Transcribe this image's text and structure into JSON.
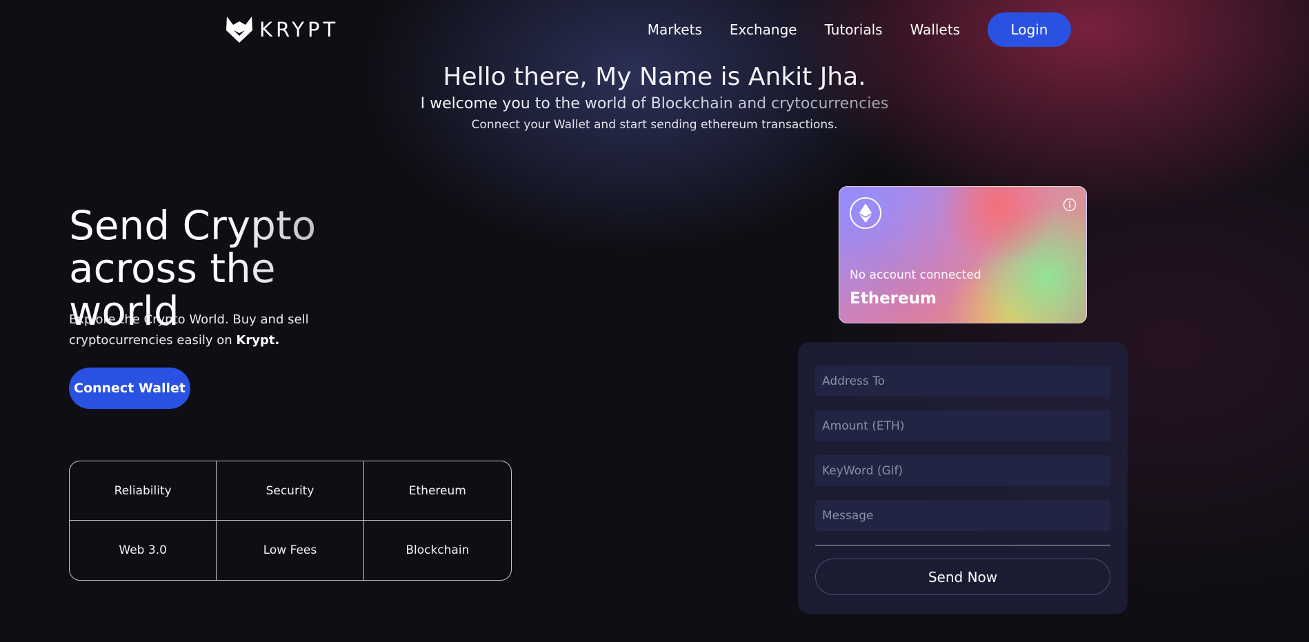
{
  "brand": {
    "name": "KRYPT",
    "logo_icon": "fox-logo-icon"
  },
  "nav": {
    "links": [
      "Markets",
      "Exchange",
      "Tutorials",
      "Wallets"
    ],
    "login_label": "Login"
  },
  "intro": {
    "heading": "Hello there, My Name is Ankit Jha.",
    "subheading": "I welcome you to the world of Blockchain and crytocurrencies",
    "text": "Connect your Wallet and start sending ethereum transactions."
  },
  "hero": {
    "title_line1": "Send Crypto",
    "title_line2": "across the world",
    "subtitle": "Explore the Crypto World. Buy and sell cryptocurrencies easily on ",
    "subtitle_brand": "Krypt.",
    "connect_label": "Connect Wallet"
  },
  "features": [
    "Reliability",
    "Security",
    "Ethereum",
    "Web 3.0",
    "Low Fees",
    "Blockchain"
  ],
  "card": {
    "icon": "ethereum-icon",
    "info_icon": "info-icon",
    "account": "No account connected",
    "network": "Ethereum"
  },
  "form": {
    "address_placeholder": "Address To",
    "amount_placeholder": "Amount (ETH)",
    "keyword_placeholder": "KeyWord (Gif)",
    "message_placeholder": "Message",
    "send_label": "Send Now"
  },
  "colors": {
    "accent": "#2952e3",
    "background": "#0f0e14",
    "panel": "#20223e",
    "input": "#212443"
  }
}
